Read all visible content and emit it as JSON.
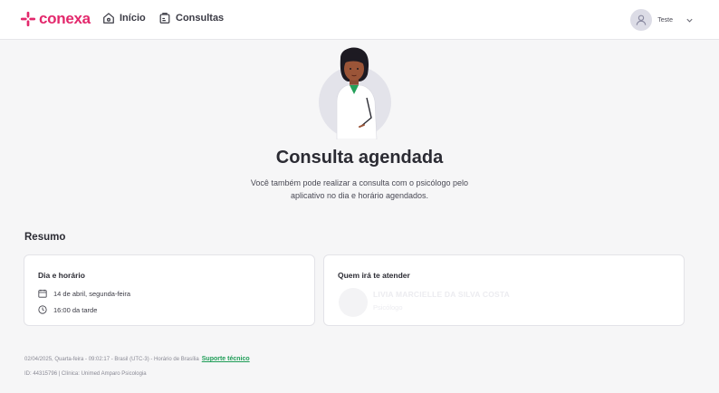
{
  "brand": {
    "name": "conexa",
    "color": "#e3286c"
  },
  "nav": {
    "home": "Início",
    "appointments": "Consultas"
  },
  "user": {
    "name": "Teste"
  },
  "hero": {
    "title": "Consulta agendada",
    "subtitle": "Você também pode realizar a consulta com o psicólogo pelo aplicativo no dia e horário agendados."
  },
  "summary": {
    "heading": "Resumo",
    "datetime_card": {
      "title": "Dia e horário",
      "date": "14 de abril, segunda-feira",
      "time": "16:00 da tarde"
    },
    "professional_card": {
      "title": "Quem irá te atender",
      "name": "LIVIA MARCIELLE DA SILVA COSTA",
      "role": "Psicólogo"
    }
  },
  "footer": {
    "datetime": "02/04/2025, Quarta-feira - 09:02:17 - Brasil (UTC-3) - Horário de Brasília",
    "support_link": "Suporte técnico",
    "id_line": "ID: 44315796 | Clínica: Unimed Amparo Psicologia"
  },
  "colors": {
    "link": "#1f9d57",
    "background": "#f6f6f7"
  }
}
